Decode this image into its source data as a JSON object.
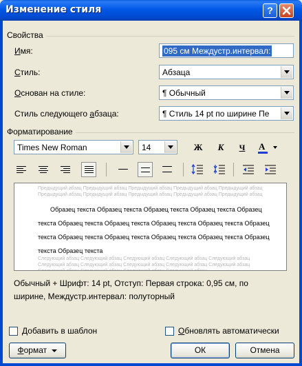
{
  "window": {
    "title": "Изменение стиля",
    "help_label": "?"
  },
  "properties": {
    "group_title": "Свойства",
    "name_label": "Имя:",
    "name_value": "095 см Междустр.интервал:",
    "style_type_label": "Стиль:",
    "style_type_value": "Абзаца",
    "based_on_label": "Основан на стиле:",
    "based_on_value": "¶ Обычный",
    "next_style_label": "Стиль следующего абзаца:",
    "next_style_value": "¶ Стиль 14 pt по ширине Пе"
  },
  "formatting": {
    "group_title": "Форматирование",
    "font_name": "Times New Roman",
    "font_size": "14",
    "bold_label": "Ж",
    "italic_label": "К",
    "underline_label": "Ч",
    "font_color_label": "А"
  },
  "preview": {
    "previous_paragraph": "Предыдущий абзац Предыдущий абзац Предыдущий абзац Предыдущий абзац Предыдущий абзац Предыдущий абзац Предыдущий абзац Предыдущий абзац Предыдущий абзац Предыдущий абзац",
    "sample_lines": [
      "Образец текста Образец текста Образец текста Образец текста Образец",
      "текста Образец текста Образец текста Образец текста Образец текста Образец",
      "текста Образец текста Образец текста Образец текста Образец текста Образец",
      "текста Образец текста"
    ],
    "next_paragraph": "Следующий абзац Следующий абзац Следующий абзац Следующий абзац Следующий абзац Следующий абзац Следующий абзац Следующий абзац Следующий абзац Следующий абзац Следующий абзац Следующий абзац Следующий абзац Следующий абзац"
  },
  "description": {
    "line1": "Обычный + Шрифт: 14 pt, Отступ: Первая строка:  0,95 см, по",
    "line2": "ширине, Междустр.интервал:  полуторный"
  },
  "options": {
    "add_to_template_label": "Добавить в шаблон",
    "auto_update_label": "Обновлять автоматически"
  },
  "buttons": {
    "format_label": "Формат",
    "ok_label": "ОК",
    "cancel_label": "Отмена"
  },
  "colors": {
    "titlebar": "#0058e6",
    "dialog_bg": "#ece9d8",
    "font_color_bar": "#1f3fd0"
  }
}
